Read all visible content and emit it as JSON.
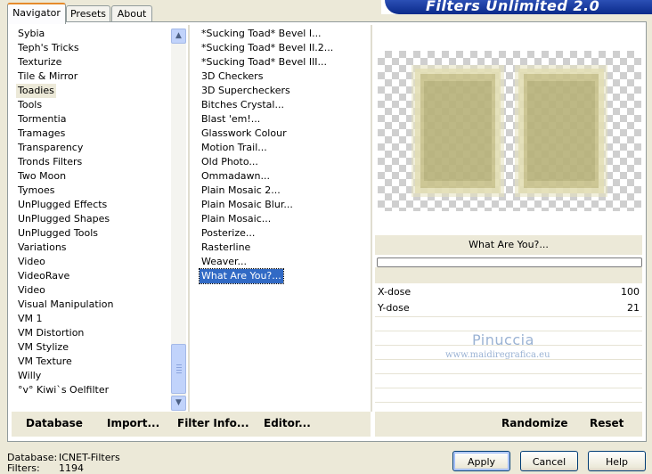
{
  "tabs": [
    "Navigator",
    "Presets",
    "About"
  ],
  "banner_title": "Filters Unlimited 2.0",
  "categories": [
    "Sybia",
    "Teph's Tricks",
    "Texturize",
    "Tile & Mirror",
    "Toadies",
    "Tools",
    "Tormentia",
    "Tramages",
    "Transparency",
    "Tronds Filters",
    "Two Moon",
    "Tymoes",
    "UnPlugged Effects",
    "UnPlugged Shapes",
    "UnPlugged Tools",
    "Variations",
    "Video",
    "VideoRave",
    "Video",
    "Visual Manipulation",
    "VM 1",
    "VM Distortion",
    "VM Stylize",
    "VM Texture",
    "Willy",
    "°v° Kiwi`s Oelfilter"
  ],
  "selected_category": "Toadies",
  "filters": [
    "*Sucking Toad*  Bevel I...",
    "*Sucking Toad*  Bevel II.2...",
    "*Sucking Toad*  Bevel III...",
    "3D Checkers",
    "3D Supercheckers",
    "Bitches Crystal...",
    "Blast 'em!...",
    "Glasswork Colour",
    "Motion Trail...",
    "Old Photo...",
    "Ommadawn...",
    "Plain Mosaic 2...",
    "Plain Mosaic Blur...",
    "Plain Mosaic...",
    "Posterize...",
    "Rasterline",
    "Weaver...",
    "What Are You?..."
  ],
  "selected_filter": "What Are You?...",
  "filter_title": "What Are You?...",
  "params": [
    {
      "name": "X-dose",
      "value": "100"
    },
    {
      "name": "Y-dose",
      "value": "21"
    }
  ],
  "watermark": {
    "line1": "Pinuccia",
    "line2": "www.maidiregrafica.eu"
  },
  "toolbar": {
    "database": "Database",
    "import": "Import...",
    "filter_info": "Filter Info...",
    "editor": "Editor...",
    "randomize": "Randomize",
    "reset": "Reset"
  },
  "status": {
    "database_label": "Database:",
    "database_value": "ICNET-Filters",
    "filters_label": "Filters:",
    "filters_value": "1194"
  },
  "buttons": {
    "apply": "Apply",
    "cancel": "Cancel",
    "help": "Help"
  },
  "colors": {
    "selection": "#316ac5",
    "banner": "#0a2a8a",
    "tab_accent": "#e68b2c"
  }
}
